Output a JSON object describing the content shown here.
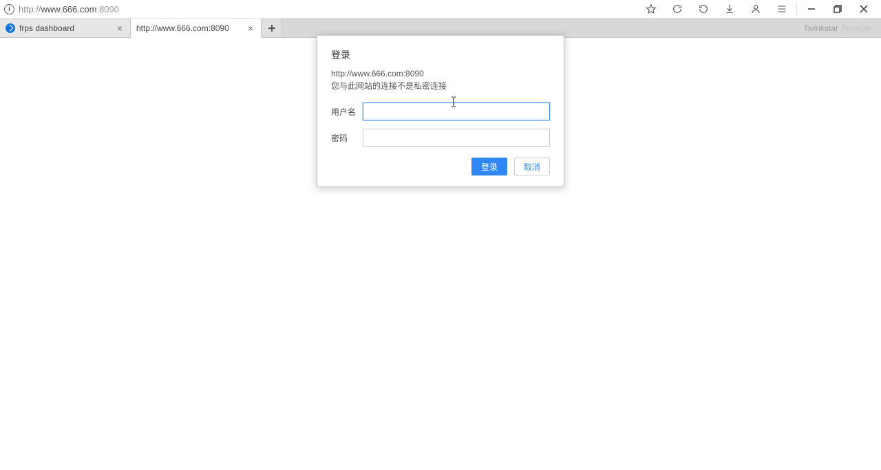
{
  "toolbar": {
    "url_scheme": "http://",
    "url_host": "www.666.com",
    "url_port": ":8090"
  },
  "tabs": [
    {
      "title": "frps dashboard",
      "active": false
    },
    {
      "title": "http://www.666.com:8090",
      "active": true
    }
  ],
  "brand": {
    "name": "Twinkstar",
    "suffix": "Browser"
  },
  "dialog": {
    "title": "登录",
    "origin": "http://www.666.com:8090",
    "warning": "您与此网站的连接不是私密连接",
    "username_label": "用户名",
    "password_label": "密码",
    "username_value": "",
    "password_value": "",
    "login_label": "登录",
    "cancel_label": "取消"
  }
}
